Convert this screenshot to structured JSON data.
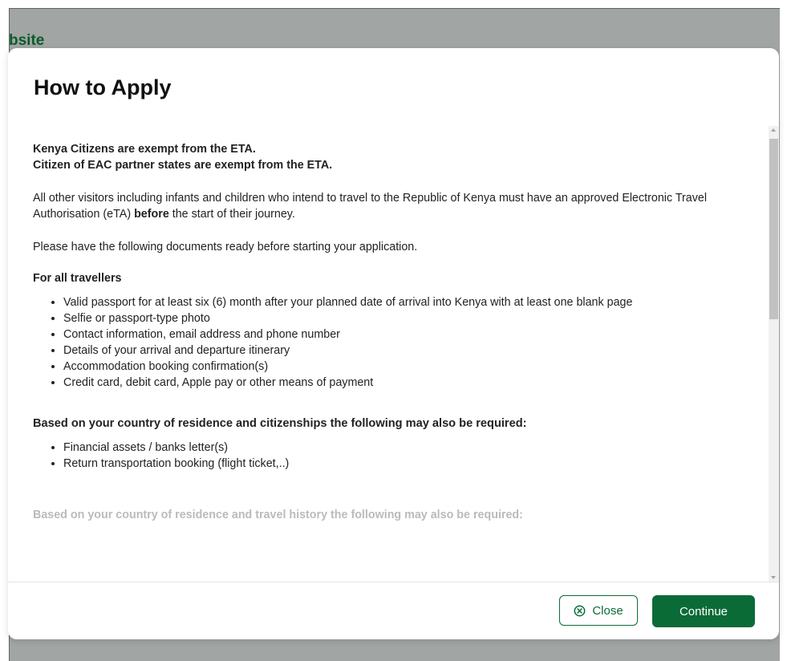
{
  "background": {
    "partial_title": "bsite"
  },
  "modal": {
    "title": "How to Apply",
    "exempt_line_1": "Kenya Citizens are exempt from the ETA.",
    "exempt_line_2": "Citizen of EAC partner states are exempt from the ETA.",
    "intro_part_1": "All other visitors including infants and children who intend to travel to the Republic of Kenya must have an approved Electronic Travel Authorisation (eTA) ",
    "intro_bold": "before",
    "intro_part_2": " the start of their journey.",
    "prepare_text": "Please have the following documents ready before starting your application.",
    "all_travellers": {
      "heading": "For all travellers",
      "items": [
        "Valid passport for at least six (6) month after your planned date of arrival into Kenya with at least one blank page",
        "Selfie or passport-type photo",
        "Contact information, email address and phone number",
        "Details of your arrival and departure itinerary",
        "Accommodation booking confirmation(s)",
        "Credit card, debit card, Apple pay or other means of payment"
      ]
    },
    "residence_citizenship": {
      "heading": "Based on your country of residence and citizenships the following may also be required:",
      "items": [
        "Financial assets / banks letter(s)",
        "Return transportation booking (flight ticket,..)"
      ]
    },
    "travel_history_heading": "Based on your country of residence and travel history the following may also be required:",
    "buttons": {
      "close_label": "Close",
      "continue_label": "Continue"
    }
  },
  "colors": {
    "brand_green": "#0b6b37",
    "backdrop": "#a1a5a3",
    "background_title": "#0a5c2c"
  },
  "icons": {
    "close": "circle-x-icon"
  }
}
